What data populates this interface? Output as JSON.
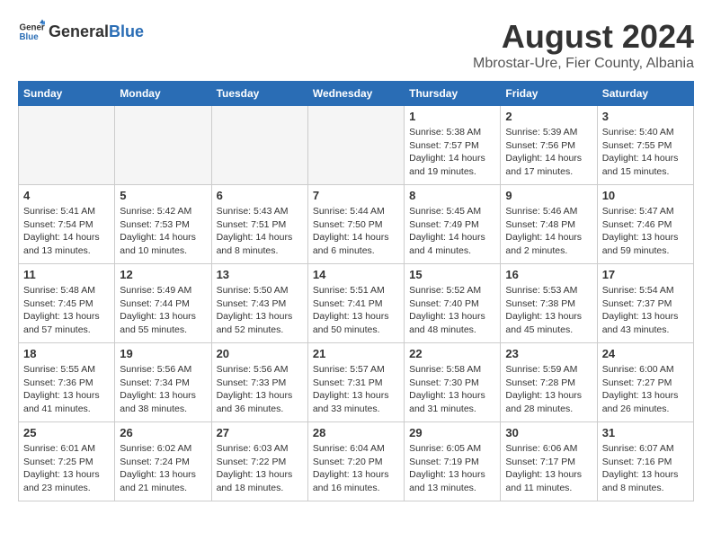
{
  "header": {
    "logo_general": "General",
    "logo_blue": "Blue",
    "month_year": "August 2024",
    "location": "Mbrostar-Ure, Fier County, Albania"
  },
  "weekdays": [
    "Sunday",
    "Monday",
    "Tuesday",
    "Wednesday",
    "Thursday",
    "Friday",
    "Saturday"
  ],
  "weeks": [
    [
      {
        "day": "",
        "info": ""
      },
      {
        "day": "",
        "info": ""
      },
      {
        "day": "",
        "info": ""
      },
      {
        "day": "",
        "info": ""
      },
      {
        "day": "1",
        "info": "Sunrise: 5:38 AM\nSunset: 7:57 PM\nDaylight: 14 hours\nand 19 minutes."
      },
      {
        "day": "2",
        "info": "Sunrise: 5:39 AM\nSunset: 7:56 PM\nDaylight: 14 hours\nand 17 minutes."
      },
      {
        "day": "3",
        "info": "Sunrise: 5:40 AM\nSunset: 7:55 PM\nDaylight: 14 hours\nand 15 minutes."
      }
    ],
    [
      {
        "day": "4",
        "info": "Sunrise: 5:41 AM\nSunset: 7:54 PM\nDaylight: 14 hours\nand 13 minutes."
      },
      {
        "day": "5",
        "info": "Sunrise: 5:42 AM\nSunset: 7:53 PM\nDaylight: 14 hours\nand 10 minutes."
      },
      {
        "day": "6",
        "info": "Sunrise: 5:43 AM\nSunset: 7:51 PM\nDaylight: 14 hours\nand 8 minutes."
      },
      {
        "day": "7",
        "info": "Sunrise: 5:44 AM\nSunset: 7:50 PM\nDaylight: 14 hours\nand 6 minutes."
      },
      {
        "day": "8",
        "info": "Sunrise: 5:45 AM\nSunset: 7:49 PM\nDaylight: 14 hours\nand 4 minutes."
      },
      {
        "day": "9",
        "info": "Sunrise: 5:46 AM\nSunset: 7:48 PM\nDaylight: 14 hours\nand 2 minutes."
      },
      {
        "day": "10",
        "info": "Sunrise: 5:47 AM\nSunset: 7:46 PM\nDaylight: 13 hours\nand 59 minutes."
      }
    ],
    [
      {
        "day": "11",
        "info": "Sunrise: 5:48 AM\nSunset: 7:45 PM\nDaylight: 13 hours\nand 57 minutes."
      },
      {
        "day": "12",
        "info": "Sunrise: 5:49 AM\nSunset: 7:44 PM\nDaylight: 13 hours\nand 55 minutes."
      },
      {
        "day": "13",
        "info": "Sunrise: 5:50 AM\nSunset: 7:43 PM\nDaylight: 13 hours\nand 52 minutes."
      },
      {
        "day": "14",
        "info": "Sunrise: 5:51 AM\nSunset: 7:41 PM\nDaylight: 13 hours\nand 50 minutes."
      },
      {
        "day": "15",
        "info": "Sunrise: 5:52 AM\nSunset: 7:40 PM\nDaylight: 13 hours\nand 48 minutes."
      },
      {
        "day": "16",
        "info": "Sunrise: 5:53 AM\nSunset: 7:38 PM\nDaylight: 13 hours\nand 45 minutes."
      },
      {
        "day": "17",
        "info": "Sunrise: 5:54 AM\nSunset: 7:37 PM\nDaylight: 13 hours\nand 43 minutes."
      }
    ],
    [
      {
        "day": "18",
        "info": "Sunrise: 5:55 AM\nSunset: 7:36 PM\nDaylight: 13 hours\nand 41 minutes."
      },
      {
        "day": "19",
        "info": "Sunrise: 5:56 AM\nSunset: 7:34 PM\nDaylight: 13 hours\nand 38 minutes."
      },
      {
        "day": "20",
        "info": "Sunrise: 5:56 AM\nSunset: 7:33 PM\nDaylight: 13 hours\nand 36 minutes."
      },
      {
        "day": "21",
        "info": "Sunrise: 5:57 AM\nSunset: 7:31 PM\nDaylight: 13 hours\nand 33 minutes."
      },
      {
        "day": "22",
        "info": "Sunrise: 5:58 AM\nSunset: 7:30 PM\nDaylight: 13 hours\nand 31 minutes."
      },
      {
        "day": "23",
        "info": "Sunrise: 5:59 AM\nSunset: 7:28 PM\nDaylight: 13 hours\nand 28 minutes."
      },
      {
        "day": "24",
        "info": "Sunrise: 6:00 AM\nSunset: 7:27 PM\nDaylight: 13 hours\nand 26 minutes."
      }
    ],
    [
      {
        "day": "25",
        "info": "Sunrise: 6:01 AM\nSunset: 7:25 PM\nDaylight: 13 hours\nand 23 minutes."
      },
      {
        "day": "26",
        "info": "Sunrise: 6:02 AM\nSunset: 7:24 PM\nDaylight: 13 hours\nand 21 minutes."
      },
      {
        "day": "27",
        "info": "Sunrise: 6:03 AM\nSunset: 7:22 PM\nDaylight: 13 hours\nand 18 minutes."
      },
      {
        "day": "28",
        "info": "Sunrise: 6:04 AM\nSunset: 7:20 PM\nDaylight: 13 hours\nand 16 minutes."
      },
      {
        "day": "29",
        "info": "Sunrise: 6:05 AM\nSunset: 7:19 PM\nDaylight: 13 hours\nand 13 minutes."
      },
      {
        "day": "30",
        "info": "Sunrise: 6:06 AM\nSunset: 7:17 PM\nDaylight: 13 hours\nand 11 minutes."
      },
      {
        "day": "31",
        "info": "Sunrise: 6:07 AM\nSunset: 7:16 PM\nDaylight: 13 hours\nand 8 minutes."
      }
    ]
  ]
}
